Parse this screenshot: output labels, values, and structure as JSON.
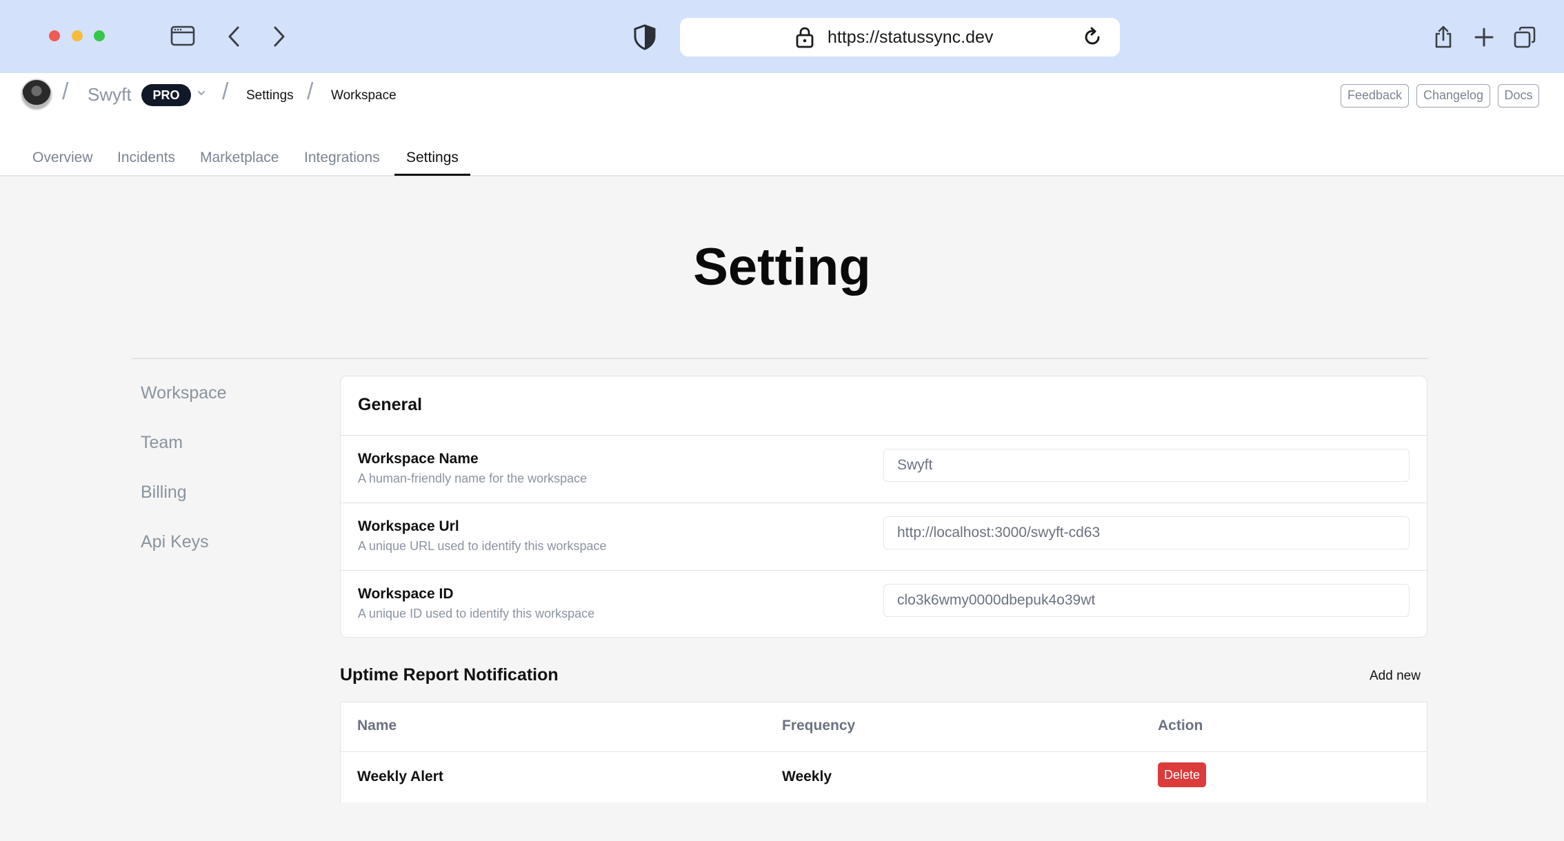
{
  "browser": {
    "url": "https://statussync.dev",
    "icons": [
      "sidebar-icon",
      "back-icon",
      "forward-icon",
      "shield-icon",
      "lock-icon",
      "reload-icon",
      "share-icon",
      "new-tab-icon",
      "tabs-overview-icon"
    ]
  },
  "header": {
    "org_name": "Swyft",
    "plan_badge": "PRO",
    "breadcrumb": [
      "Settings",
      "Workspace"
    ],
    "actions": [
      "Feedback",
      "Changelog",
      "Docs"
    ]
  },
  "tabs": [
    {
      "label": "Overview",
      "active": false
    },
    {
      "label": "Incidents",
      "active": false
    },
    {
      "label": "Marketplace",
      "active": false
    },
    {
      "label": "Integrations",
      "active": false
    },
    {
      "label": "Settings",
      "active": true
    }
  ],
  "page": {
    "title": "Setting"
  },
  "sidebar": {
    "items": [
      {
        "label": "Workspace"
      },
      {
        "label": "Team"
      },
      {
        "label": "Billing"
      },
      {
        "label": "Api Keys"
      }
    ]
  },
  "general": {
    "title": "General",
    "fields": [
      {
        "label": "Workspace Name",
        "help": "A human-friendly name for the workspace",
        "value": "Swyft"
      },
      {
        "label": "Workspace Url",
        "help": "A unique URL used to identify this workspace",
        "value": "http://localhost:3000/swyft-cd63"
      },
      {
        "label": "Workspace ID",
        "help": "A unique ID used to identify this workspace",
        "value": "clo3k6wmy0000dbepuk4o39wt"
      }
    ]
  },
  "uptime": {
    "title": "Uptime Report Notification",
    "add_label": "Add new",
    "columns": [
      "Name",
      "Frequency",
      "Action"
    ],
    "rows": [
      {
        "name": "Weekly Alert",
        "frequency": "Weekly",
        "action": "Delete"
      }
    ]
  },
  "colors": {
    "chrome_bg": "#d3e1fb",
    "main_bg": "#f5f5f5",
    "delete": "#dc3b3b",
    "badge": "#111827"
  }
}
